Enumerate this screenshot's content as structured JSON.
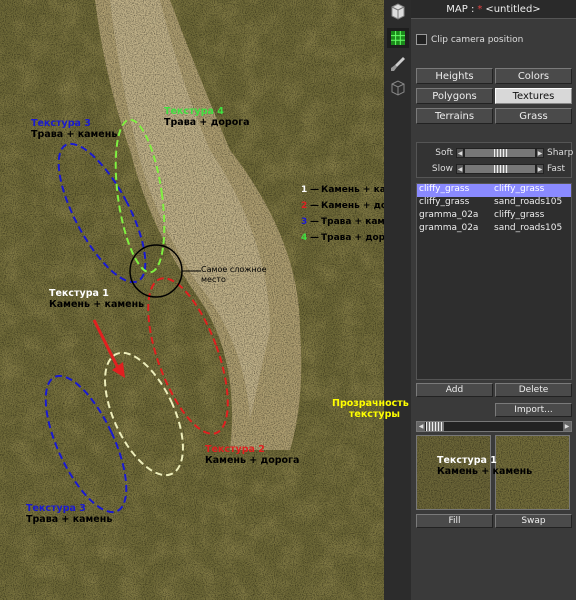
{
  "panel": {
    "title_prefix": "MAP :",
    "title_star": "*",
    "title_name": "<untitled>",
    "clip_camera": "Clip camera position",
    "tabs": [
      "Heights",
      "Colors",
      "Polygons",
      "Textures",
      "Terrains",
      "Grass"
    ],
    "selected_tab": "Textures",
    "soft_label": "Soft",
    "sharp_label": "Sharp",
    "slow_label": "Slow",
    "fast_label": "Fast",
    "texture_pairs": [
      {
        "a": "cliffy_grass",
        "b": "cliffy_grass"
      },
      {
        "a": "cliffy_grass",
        "b": "sand_roads105"
      },
      {
        "a": "gramma_02a",
        "b": "cliffy_grass"
      },
      {
        "a": "gramma_02a",
        "b": "sand_roads105"
      }
    ],
    "add_label": "Add",
    "delete_label": "Delete",
    "import_label": "Import...",
    "fill_label": "Fill",
    "swap_label": "Swap"
  },
  "annotations": {
    "tex3_top": {
      "head": "Текстура 3",
      "sub": "Трава + камень"
    },
    "tex4": {
      "head": "Текстура 4",
      "sub": "Трава + дорога"
    },
    "tex1_mid": {
      "head": "Текстура 1",
      "sub": "Камень + камень"
    },
    "tex2": {
      "head": "Текстура 2",
      "sub": "Камень + дорога"
    },
    "tex3_bottom": {
      "head": "Текстура 3",
      "sub": "Трава + камень"
    },
    "hardest_place": [
      "Самое сложное",
      "место"
    ],
    "opacity_note": [
      "Прозрачность",
      "текстуры"
    ],
    "preview_note": {
      "head": "Текстура 1",
      "sub": "Камень + камень"
    }
  },
  "legend": [
    {
      "num": "1",
      "text": "Камень + камень",
      "color": "#ffffff"
    },
    {
      "num": "2",
      "text": "Камень + дорога",
      "color": "#e02020"
    },
    {
      "num": "3",
      "text": "Трава + камень",
      "color": "#1a1ad0"
    },
    {
      "num": "4",
      "text": "Трава + дорога",
      "color": "#40e040"
    }
  ],
  "colors": {
    "white": "#ffffff",
    "red": "#e02020",
    "blue": "#1a1ad0",
    "green": "#80f040",
    "yellow": "#ffff00",
    "selected_row": "#8a8aff"
  },
  "icons": [
    "select-tool-icon",
    "grid-tool-icon",
    "brush-tool-icon",
    "cube-tool-icon"
  ]
}
